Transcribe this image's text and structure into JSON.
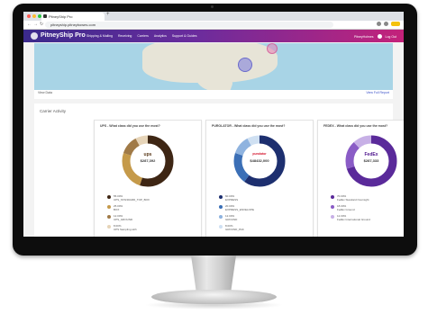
{
  "browser": {
    "tab_title": "PitneyShip Pro",
    "url": "pitneyship.pitneybowes.com"
  },
  "app": {
    "logo_text": "PitneyShip Pro",
    "nav": [
      "Shipping & Mailing",
      "Receiving",
      "Carriers",
      "Analytics",
      "Support & Guides"
    ],
    "user_label": "PitneyHolmes",
    "logout_label": "Log Out"
  },
  "map": {
    "footer_left": "View Data",
    "footer_right": "View Full Report"
  },
  "activity": {
    "title": "Carrier Activity",
    "carriers": [
      {
        "question": "UPS - What class did you use the most?",
        "logo": "ups",
        "logo_color": "#5a3a1a",
        "total": "$287,392",
        "segments": [
          {
            "pct": 55,
            "color": "#3e2614"
          },
          {
            "pct": 25,
            "color": "#c59a4a"
          },
          {
            "pct": 12,
            "color": "#a07a47"
          },
          {
            "pct": 8,
            "color": "#e6d4b8"
          }
        ],
        "legend": [
          {
            "label": "55.00%",
            "sub": "UPS_STANDARD_TOP_BOX",
            "color": "#3e2614"
          },
          {
            "label": "25.00%",
            "sub": "BOX",
            "color": "#c59a4a"
          },
          {
            "label": "12.00%",
            "sub": "UPS_GROUND",
            "color": "#a07a47"
          },
          {
            "label": "8.00%",
            "sub": "UPS Sampling with",
            "color": "#e6d4b8"
          }
        ]
      },
      {
        "question": "PUROLATOR - What class did you use the most?",
        "logo": "purolator",
        "logo_color": "#d3122a",
        "total": "$48432,000",
        "segments": [
          {
            "pct": 60,
            "color": "#1d2f6f"
          },
          {
            "pct": 20,
            "color": "#3b6fb6"
          },
          {
            "pct": 12,
            "color": "#8fb3df"
          },
          {
            "pct": 8,
            "color": "#cfe0f2"
          }
        ],
        "legend": [
          {
            "label": "60.00%",
            "sub": "EXPRESS",
            "color": "#1d2f6f"
          },
          {
            "label": "20.00%",
            "sub": "EXPRESS_ENVELOPE",
            "color": "#3b6fb6"
          },
          {
            "label": "12.00%",
            "sub": "GROUND",
            "color": "#8fb3df"
          },
          {
            "label": "8.00%",
            "sub": "GROUND_PAK",
            "color": "#cfe0f2"
          }
        ]
      },
      {
        "question": "FEDEX - What class did you use the most?",
        "logo": "FedEx",
        "logo_color": "#4d148c",
        "total": "$287,333",
        "segments": [
          {
            "pct": 70,
            "color": "#5a2a9a"
          },
          {
            "pct": 18,
            "color": "#8a5cc6"
          },
          {
            "pct": 12,
            "color": "#c7b0e6"
          }
        ],
        "legend": [
          {
            "label": "70.00%",
            "sub": "FedEx Standard Overnight",
            "color": "#5a2a9a"
          },
          {
            "label": "18.00%",
            "sub": "FedEx Ground",
            "color": "#8a5cc6"
          },
          {
            "label": "12.00%",
            "sub": "FedEx International Ground",
            "color": "#c7b0e6"
          }
        ]
      }
    ]
  }
}
